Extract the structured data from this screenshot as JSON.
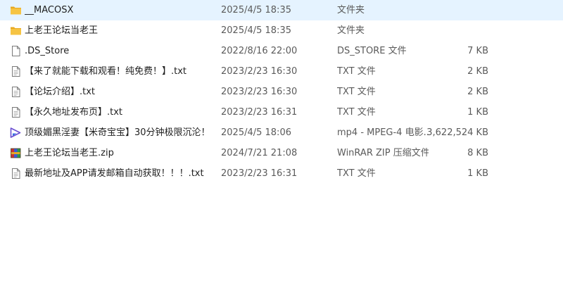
{
  "files": [
    {
      "name": "__MACOSX",
      "date": "2025/4/5 18:35",
      "type": "文件夹",
      "size": "",
      "icon": "folder-icon"
    },
    {
      "name": "上老王论坛当老王",
      "date": "2025/4/5 18:35",
      "type": "文件夹",
      "size": "",
      "icon": "folder-icon"
    },
    {
      "name": ".DS_Store",
      "date": "2022/8/16 22:00",
      "type": "DS_STORE 文件",
      "size": "7 KB",
      "icon": "blank-file-icon"
    },
    {
      "name": "【来了就能下载和观看！纯免费！】.txt",
      "date": "2023/2/23 16:30",
      "type": "TXT 文件",
      "size": "2 KB",
      "icon": "text-file-icon"
    },
    {
      "name": "【论坛介绍】.txt",
      "date": "2023/2/23 16:30",
      "type": "TXT 文件",
      "size": "2 KB",
      "icon": "text-file-icon"
    },
    {
      "name": "【永久地址发布页】.txt",
      "date": "2023/2/23 16:31",
      "type": "TXT 文件",
      "size": "1 KB",
      "icon": "text-file-icon"
    },
    {
      "name": "顶级媚黑淫妻【米奇宝宝】30分钟极限沉沦！....",
      "date": "2025/4/5 18:06",
      "type": "mp4 - MPEG-4 电影...",
      "size": "3,622,524 KB",
      "icon": "video-file-icon"
    },
    {
      "name": "上老王论坛当老王.zip",
      "date": "2024/7/21 21:08",
      "type": "WinRAR ZIP 压缩文件",
      "size": "8 KB",
      "icon": "winrar-archive-icon"
    },
    {
      "name": "最新地址及APP请发邮箱自动获取！！！.txt",
      "date": "2023/2/23 16:31",
      "type": "TXT 文件",
      "size": "1 KB",
      "icon": "text-file-icon"
    }
  ],
  "colors": {
    "folder": "#f6c443",
    "folder_dark": "#e8a921",
    "video": "#6b4fd1",
    "archive_blue": "#3b5bd6",
    "archive_red": "#c8352f",
    "archive_gold": "#e0a92a"
  }
}
